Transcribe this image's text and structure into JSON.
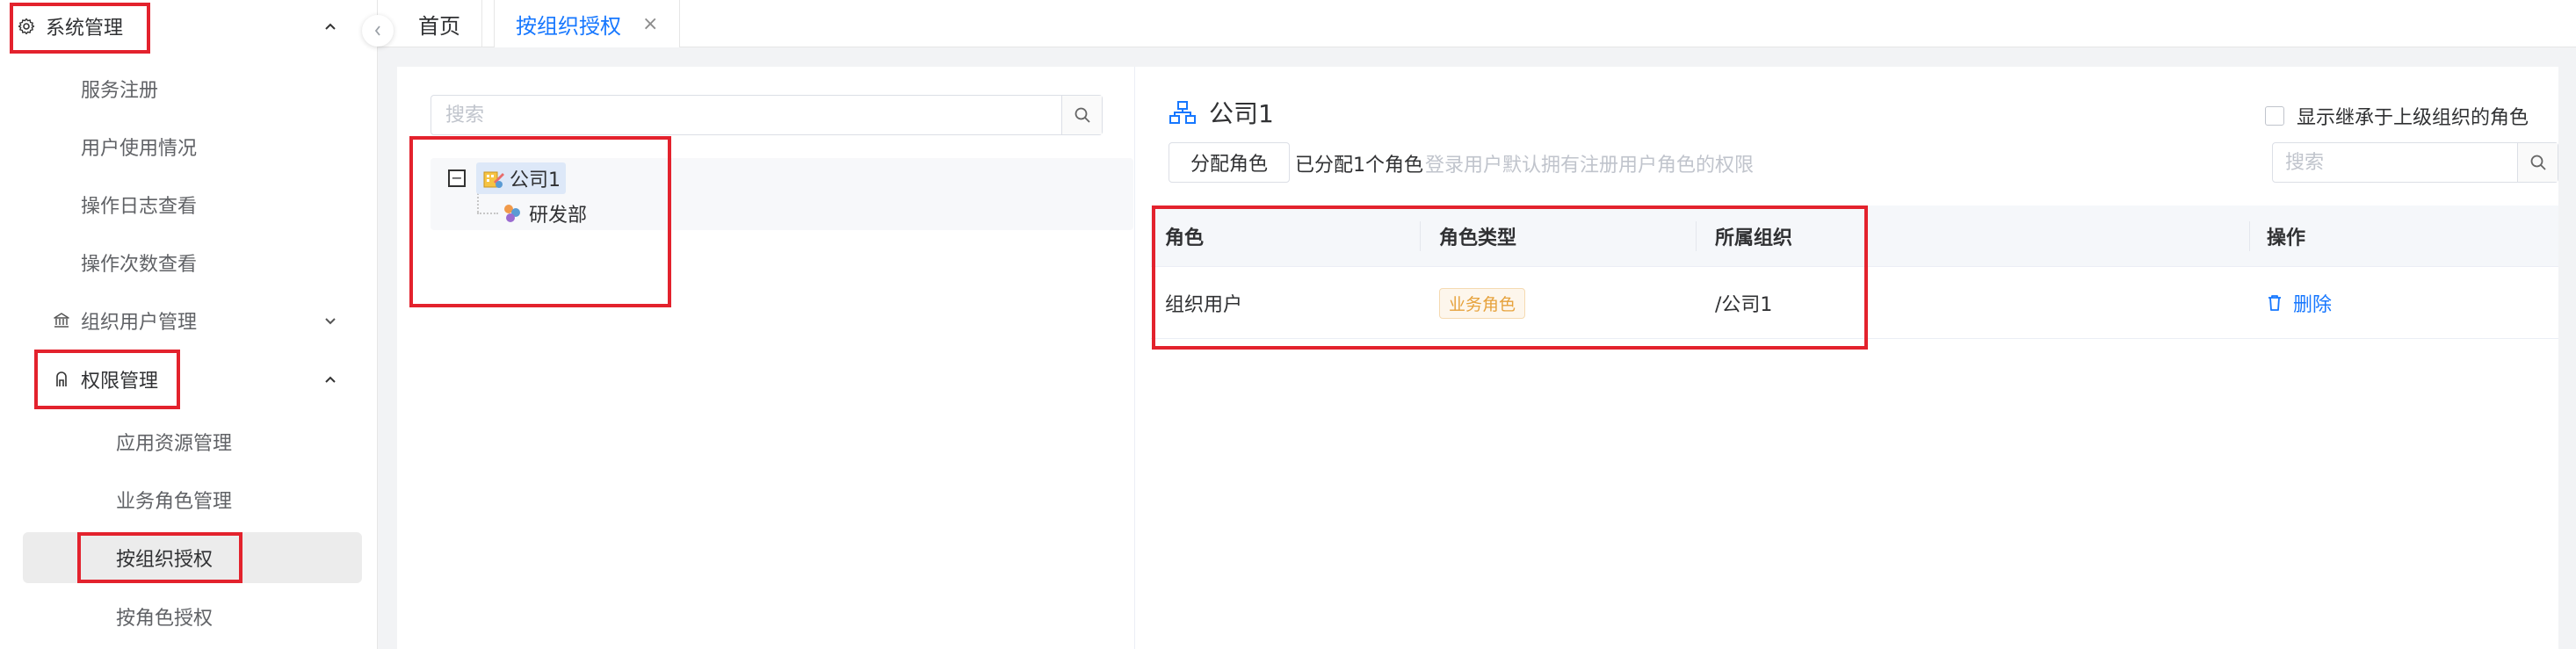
{
  "sidebar": {
    "items": [
      {
        "label": "系统管理",
        "icon": "gear-icon",
        "expanded": true
      },
      {
        "label": "服务注册"
      },
      {
        "label": "用户使用情况"
      },
      {
        "label": "操作日志查看"
      },
      {
        "label": "操作次数查看"
      },
      {
        "label": "组织用户管理",
        "icon": "bank-icon",
        "expanded": false
      },
      {
        "label": "权限管理",
        "icon": "lock-icon",
        "expanded": true
      },
      {
        "label": "应用资源管理"
      },
      {
        "label": "业务角色管理"
      },
      {
        "label": "按组织授权",
        "active": true
      },
      {
        "label": "按角色授权"
      }
    ]
  },
  "tabs": [
    {
      "label": "首页"
    },
    {
      "label": "按组织授权",
      "active": true,
      "close": "×"
    }
  ],
  "tree_panel": {
    "search_placeholder": "搜索",
    "nodes": [
      {
        "label": "公司1",
        "selected": true,
        "toggle": "−"
      },
      {
        "label": "研发部"
      }
    ]
  },
  "detail": {
    "org_name": "公司1",
    "inherit_label": "显示继承于上级组织的角色",
    "assign_button": "分配角色",
    "assigned_count": "已分配1个角色",
    "hint": "登录用户默认拥有注册用户角色的权限",
    "search_placeholder": "搜索",
    "table": {
      "columns": [
        "角色",
        "角色类型",
        "所属组织",
        "操作"
      ],
      "rows": [
        {
          "role": "组织用户",
          "type": "业务角色",
          "org": "/公司1",
          "action": "删除"
        }
      ]
    }
  },
  "colors": {
    "accent": "#1677ff",
    "highlight_box": "#e3222d",
    "tag_text": "#e6a23c"
  }
}
